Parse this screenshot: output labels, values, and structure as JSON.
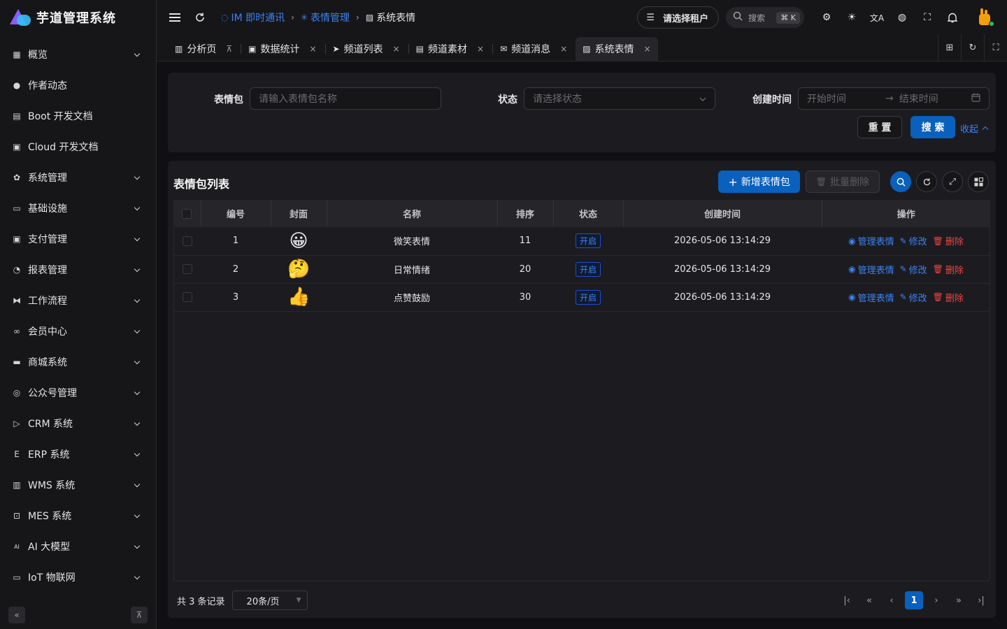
{
  "app": {
    "title": "芋道管理系统"
  },
  "sidebar": {
    "items": [
      {
        "label": "概览",
        "icon": "grid-icon",
        "glyph": "▦",
        "expandable": true
      },
      {
        "label": "作者动态",
        "icon": "user-icon",
        "glyph": "●",
        "expandable": false
      },
      {
        "label": "Boot 开发文档",
        "icon": "document-icon",
        "glyph": "▤",
        "expandable": false
      },
      {
        "label": "Cloud 开发文档",
        "icon": "document-copy-icon",
        "glyph": "▣",
        "expandable": false
      },
      {
        "label": "系统管理",
        "icon": "gear-icon",
        "glyph": "✿",
        "expandable": true
      },
      {
        "label": "基础设施",
        "icon": "monitor-icon",
        "glyph": "▭",
        "expandable": true
      },
      {
        "label": "支付管理",
        "icon": "payment-icon",
        "glyph": "▣",
        "expandable": true
      },
      {
        "label": "报表管理",
        "icon": "pie-chart-icon",
        "glyph": "◔",
        "expandable": true
      },
      {
        "label": "工作流程",
        "icon": "workflow-icon",
        "glyph": "⧓",
        "expandable": true
      },
      {
        "label": "会员中心",
        "icon": "bicycle-icon",
        "glyph": "∞",
        "expandable": true
      },
      {
        "label": "商城系统",
        "icon": "shop-icon",
        "glyph": "▬",
        "expandable": true
      },
      {
        "label": "公众号管理",
        "icon": "compass-icon",
        "glyph": "◎",
        "expandable": true
      },
      {
        "label": "CRM 系统",
        "icon": "crm-icon",
        "glyph": "▷",
        "expandable": true
      },
      {
        "label": "ERP 系统",
        "icon": "erp-icon",
        "glyph": "E",
        "expandable": true
      },
      {
        "label": "WMS 系统",
        "icon": "warehouse-icon",
        "glyph": "▥",
        "expandable": true
      },
      {
        "label": "MES 系统",
        "icon": "chip-icon",
        "glyph": "⊡",
        "expandable": true
      },
      {
        "label": "AI 大模型",
        "icon": "ai-icon",
        "glyph": "AI",
        "expandable": true
      },
      {
        "label": "IoT 物联网",
        "icon": "iot-icon",
        "glyph": "▭",
        "expandable": true
      }
    ],
    "collapse_glyph": "«",
    "pin_glyph": "⊼"
  },
  "header": {
    "breadcrumb": [
      {
        "label": "IM 即时通讯",
        "icon": "chat-icon",
        "glyph": "◌",
        "current": false
      },
      {
        "label": "表情管理",
        "icon": "sparkle-icon",
        "glyph": "✳",
        "current": false
      },
      {
        "label": "系统表情",
        "icon": "image-icon",
        "glyph": "▨",
        "current": true
      }
    ],
    "tenant_label": "请选择租户",
    "search_label": "搜索",
    "search_kbd": "⌘ K"
  },
  "tabs": [
    {
      "label": "分析页",
      "icon": "chart-icon",
      "glyph": "▥",
      "close_icon": "pin-icon",
      "close_glyph": "⊼",
      "active": false
    },
    {
      "label": "数据统计",
      "icon": "image-icon",
      "glyph": "▣",
      "close_icon": "close-icon",
      "close_glyph": "×",
      "active": false
    },
    {
      "label": "频道列表",
      "icon": "send-icon",
      "glyph": "➤",
      "close_icon": "close-icon",
      "close_glyph": "×",
      "active": false
    },
    {
      "label": "频道素材",
      "icon": "document-icon",
      "glyph": "▤",
      "close_icon": "close-icon",
      "close_glyph": "×",
      "active": false
    },
    {
      "label": "频道消息",
      "icon": "mail-icon",
      "glyph": "✉",
      "close_icon": "close-icon",
      "close_glyph": "×",
      "active": false
    },
    {
      "label": "系统表情",
      "icon": "image-icon",
      "glyph": "▨",
      "close_icon": "close-icon",
      "close_glyph": "×",
      "active": true
    }
  ],
  "filter": {
    "pack_label": "表情包",
    "pack_placeholder": "请输入表情包名称",
    "status_label": "状态",
    "status_placeholder": "请选择状态",
    "created_label": "创建时间",
    "start_placeholder": "开始时间",
    "range_arrow": "→",
    "end_placeholder": "结束时间",
    "reset_label": "重 置",
    "search_label": "搜 索",
    "collapse_label": "收起"
  },
  "table": {
    "title": "表情包列表",
    "add_label": "新增表情包",
    "batch_delete_label": "批量删除",
    "columns": [
      "编号",
      "封面",
      "名称",
      "排序",
      "状态",
      "创建时间",
      "操作"
    ],
    "rows": [
      {
        "id": "1",
        "cover": "😀",
        "name": "微笑表情",
        "sort": "11",
        "status": "开启",
        "created": "2026-05-06 13:14:29"
      },
      {
        "id": "2",
        "cover": "🤔",
        "name": "日常情绪",
        "sort": "20",
        "status": "开启",
        "created": "2026-05-06 13:14:29"
      },
      {
        "id": "3",
        "cover": "👍",
        "name": "点赞鼓励",
        "sort": "30",
        "status": "开启",
        "created": "2026-05-06 13:14:29"
      }
    ],
    "actions": {
      "manage": "管理表情",
      "edit": "修改",
      "delete": "删除"
    }
  },
  "pager": {
    "total_text": "共 3 条记录",
    "page_size": "20条/页",
    "current_page": "1"
  },
  "colors": {
    "primary": "#0960bd",
    "link": "#3b82f6",
    "danger": "#ef4444",
    "background": "#101014"
  }
}
